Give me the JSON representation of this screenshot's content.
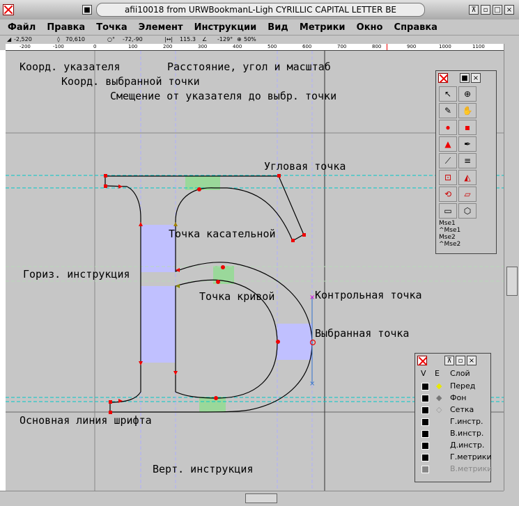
{
  "window": {
    "title": "afii10018 from URWBookmanL-Ligh CYRILLIC CAPITAL LETTER BE"
  },
  "menu": [
    "Файл",
    "Правка",
    "Точка",
    "Элемент",
    "Инструкции",
    "Вид",
    "Метрики",
    "Окно",
    "Справка"
  ],
  "status": {
    "pointer": "-2,520",
    "selected": "70,610",
    "offset": "-72,-90",
    "distance": "115.3",
    "angle": "-129°",
    "zoom": "50%"
  },
  "ruler": {
    "ticks": [
      "-200",
      "-100",
      "0",
      "100",
      "200",
      "300",
      "400",
      "500",
      "600",
      "700",
      "800",
      "900",
      "1000",
      "1100"
    ]
  },
  "annotations": {
    "pointer_coords": "Коорд. указателя",
    "distance_angle_scale": "Расстояние, угол и масштаб",
    "selected_coords": "Коорд. выбранной точки",
    "offset_to_selected": "Смещение от указателя до выбр. точки",
    "corner_point": "Угловая точка",
    "tangent_point": "Точка касательной",
    "horiz_hint": "Гориз. инструкция",
    "curve_point": "Точка кривой",
    "control_point": "Контрольная точка",
    "selected_point": "Выбранная точка",
    "baseline": "Основная линия шрифта",
    "vert_hint": "Верт. инструкция"
  },
  "tools_palette": {
    "mouse_labels": [
      "Mse1",
      "^Mse1",
      "Mse2",
      "^Mse2"
    ]
  },
  "layers": {
    "header_v": "V",
    "header_e": "E",
    "header_layer": "Слой",
    "rows": [
      "Перед",
      "Фон",
      "Сетка",
      "Г.инстр.",
      "В.инстр.",
      "Д.инстр.",
      "Г.метрики",
      "В.метрики"
    ]
  },
  "colors": {
    "guide": "#00c8c8",
    "hint": "#c0c0ff",
    "hint_green": "#9ad89a",
    "point": "#e00000",
    "control": "#e000e0"
  }
}
